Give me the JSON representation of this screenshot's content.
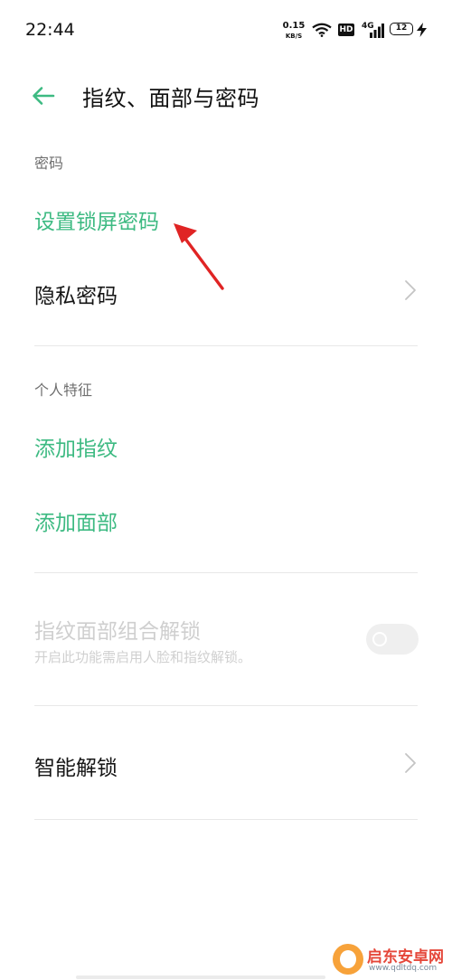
{
  "status_bar": {
    "time": "22:44",
    "net_speed_value": "0.15",
    "net_speed_unit": "KB/S",
    "hd_label": "HD",
    "signal_label": "4G",
    "battery_level": "12",
    "icons": [
      "wifi-icon",
      "signal-icon",
      "battery-icon",
      "charging-bolt-icon"
    ]
  },
  "header": {
    "title": "指纹、面部与密码",
    "back_icon": "arrow-left-icon"
  },
  "sections": {
    "password": {
      "label": "密码",
      "set_lock_password": "设置锁屏密码",
      "privacy_password": "隐私密码"
    },
    "biometrics": {
      "label": "个人特征",
      "add_fingerprint": "添加指纹",
      "add_face": "添加面部"
    },
    "combo_unlock": {
      "title": "指纹面部组合解锁",
      "description": "开启此功能需启用人脸和指纹解锁。",
      "enabled": false
    },
    "smart_unlock": {
      "title": "智能解锁"
    }
  },
  "colors": {
    "accent_green": "#3dba82",
    "annotation_red": "#e02424",
    "disabled_text": "#cfcfcf"
  },
  "watermark": {
    "title": "启东安卓网",
    "url": "www.qdltdq.com"
  }
}
